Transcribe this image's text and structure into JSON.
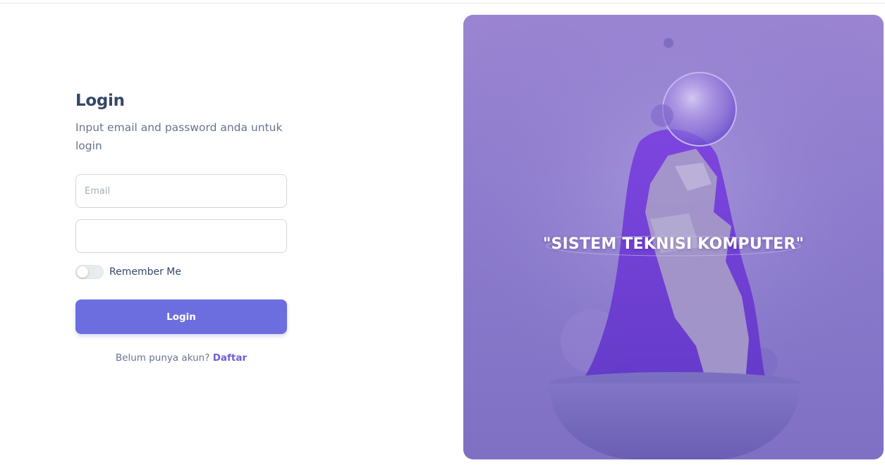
{
  "login": {
    "title": "Login",
    "subtitle": "Input email and password anda untuk login",
    "email": {
      "placeholder": "Email",
      "value": ""
    },
    "password": {
      "placeholder": "",
      "value": ""
    },
    "remember_label": "Remember Me",
    "remember_checked": false,
    "submit_label": "Login",
    "signup_prompt": "Belum punya akun?",
    "signup_link": "Daftar"
  },
  "hero": {
    "caption": "\"SISTEM TEKNISI KOMPUTER\""
  },
  "colors": {
    "accent": "#6c6ee0",
    "link": "#6c5fd6",
    "title": "#344767",
    "hero_overlay": "#8d7ccd"
  }
}
